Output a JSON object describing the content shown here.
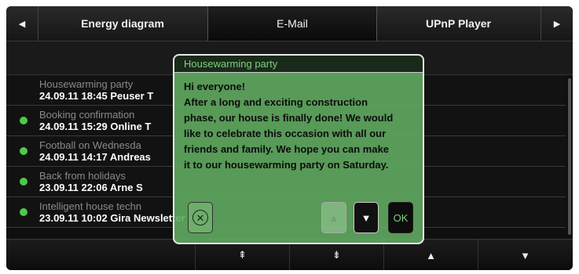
{
  "tabs": {
    "left_arrow": "◀",
    "right_arrow": "▶",
    "items": [
      {
        "label": "Energy diagram"
      },
      {
        "label": "E-Mail"
      },
      {
        "label": "UPnP Player"
      }
    ]
  },
  "messages": [
    {
      "subject": "Housewarming party",
      "meta": "24.09.11 18:45 Peuser T",
      "unread": false
    },
    {
      "subject": "Booking confirmation",
      "meta": "24.09.11 15:29 Online T",
      "unread": true
    },
    {
      "subject": "Football on Wednesda",
      "meta": "24.09.11 14:17 Andreas",
      "unread": true
    },
    {
      "subject": "Back from holidays",
      "meta": "23.09.11 22:06 Arne S",
      "unread": true
    },
    {
      "subject": "Intelligent house techn",
      "meta": "23.09.11 10:02 Gira Newsletter",
      "unread": true
    }
  ],
  "bottombar": {
    "scroll_top": "⇞",
    "scroll_bottom": "⇟",
    "up": "▲",
    "down": "▼"
  },
  "dialog": {
    "title": "Housewarming party",
    "body_lines": [
      "Hi everyone!",
      "After a long and exciting construction",
      "phase, our house is finally done! We would",
      "like to celebrate this occasion with all our",
      "friends and family. We hope you can make",
      "it to our housewarming party on Saturday."
    ],
    "close_icon": "⊗",
    "up_icon": "▲",
    "down_icon": "▼",
    "ok_label": "OK"
  },
  "colors": {
    "unread_dot": "#4cc94c",
    "dialog_bg": "#60aa60",
    "dialog_title_text": "#7fd07f"
  }
}
